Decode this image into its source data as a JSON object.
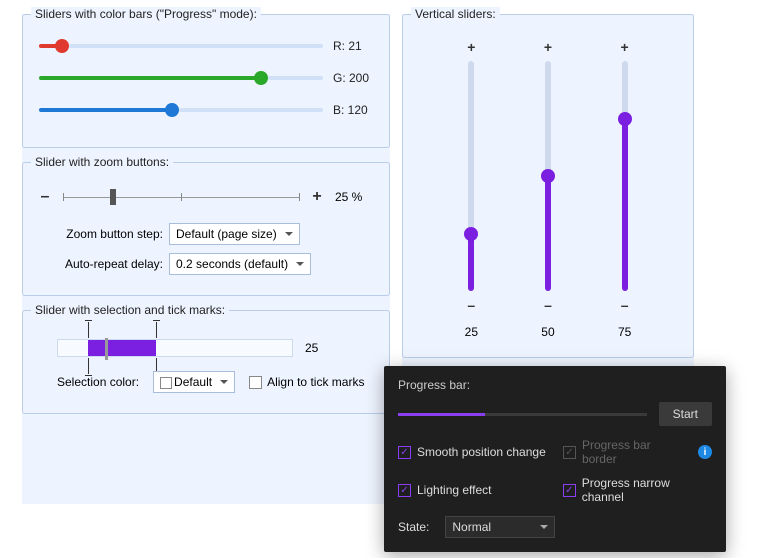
{
  "group1": {
    "title": "Sliders with color bars (\"Progress\" mode):",
    "rows": [
      {
        "color": "#e03a2f",
        "pct": 8,
        "label": "R: 21"
      },
      {
        "color": "#2aa82a",
        "pct": 78,
        "label": "G: 200"
      },
      {
        "color": "#1e78d6",
        "pct": 47,
        "label": "B: 120"
      }
    ]
  },
  "group2": {
    "title": "Slider with zoom buttons:",
    "minus": "–",
    "plus": "+",
    "value": "25 %",
    "thumb_pct": 20,
    "step_label": "Zoom button step:",
    "step_value": "Default (page size)",
    "delay_label": "Auto-repeat delay:",
    "delay_value": "0.2 seconds (default)"
  },
  "group3": {
    "title": "Slider with selection and tick marks:",
    "value": "25",
    "sel_start_pct": 13,
    "sel_end_pct": 42,
    "thumb_pct": 20,
    "color_label": "Selection color:",
    "color_value": "Default",
    "align_label": "Align to tick marks"
  },
  "vertical": {
    "title": "Vertical sliders:",
    "plus": "+",
    "minus": "–",
    "sliders": [
      {
        "value": "25",
        "pct": 25
      },
      {
        "value": "50",
        "pct": 50
      },
      {
        "value": "75",
        "pct": 75
      }
    ]
  },
  "dark": {
    "title": "Progress bar:",
    "progress_pct": 35,
    "start": "Start",
    "smooth": "Smooth position change",
    "lighting": "Lighting effect",
    "border": "Progress bar border",
    "narrow": "Progress narrow channel",
    "state_label": "State:",
    "state_value": "Normal"
  }
}
